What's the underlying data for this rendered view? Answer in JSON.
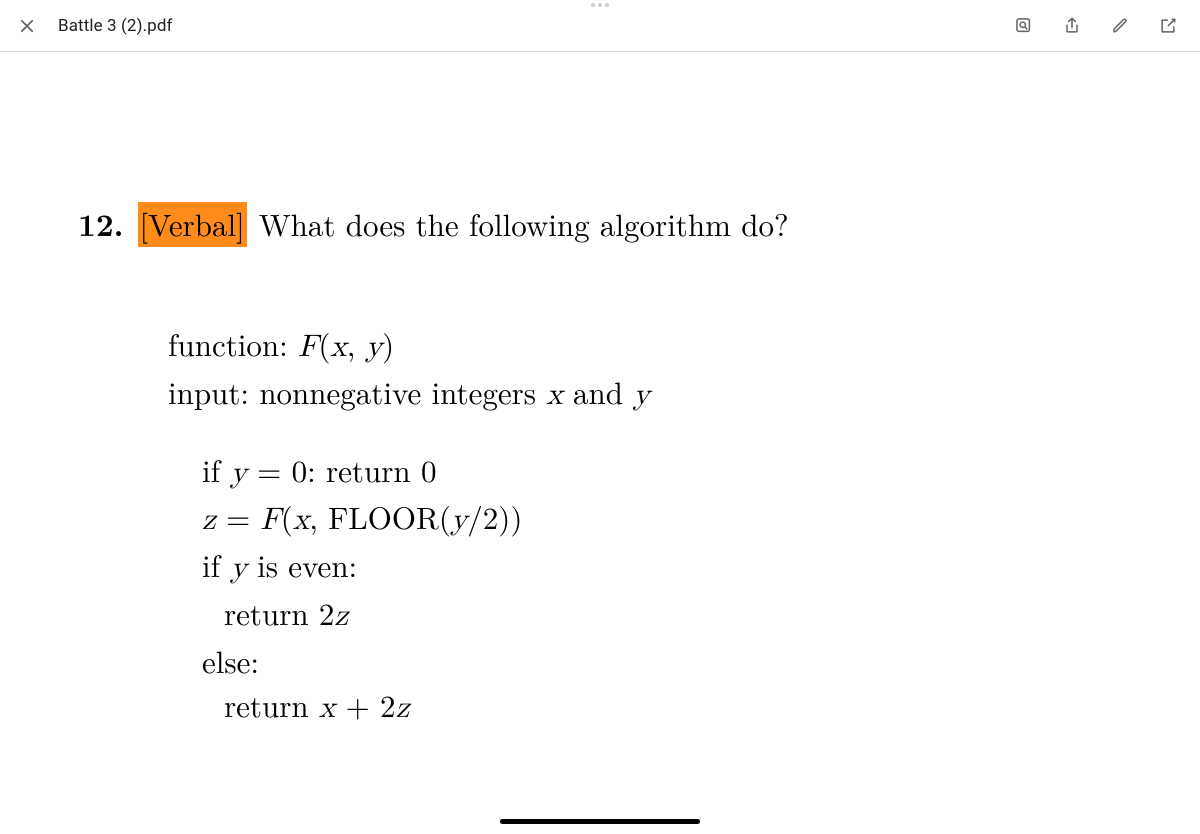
{
  "toolbar": {
    "title": "Battle 3 (2).pdf"
  },
  "question": {
    "number": "12.",
    "tag": "[Verbal]",
    "prompt": "What does the following algorithm do?"
  },
  "algo": {
    "l1a": "function:  ",
    "l1b": "F",
    "l1c": "(",
    "l1d": "x",
    "l1e": ", ",
    "l1f": "y",
    "l1g": ")",
    "l2a": "input:  nonnegative integers ",
    "l2x": "x",
    "l2b": " and ",
    "l2y": "y",
    "l3a": "if ",
    "l3y": "y",
    "l3b": " = 0:  return 0",
    "l4z": "z",
    "l4a": " = ",
    "l4f": "F",
    "l4b": "(",
    "l4x": "x",
    "l4c": ", FLOOR(",
    "l4y": "y",
    "l4d": "/2))",
    "l5a": "if ",
    "l5y": "y",
    "l5b": " is even:",
    "l6a": "return 2",
    "l6z": "z",
    "l7a": "else:",
    "l8a": "return ",
    "l8x": "x",
    "l8b": " + 2",
    "l8z": "z"
  }
}
